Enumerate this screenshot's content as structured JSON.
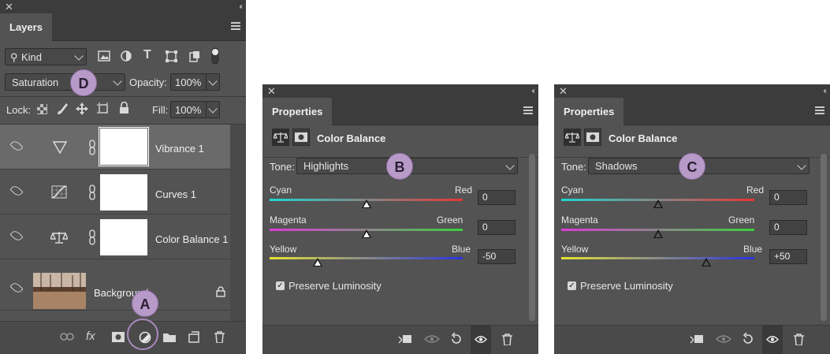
{
  "badges": {
    "a": "A",
    "b": "B",
    "c": "C",
    "d": "D"
  },
  "layers_panel": {
    "tab": "Layers",
    "filter_kind": "Kind",
    "blend_mode": "Saturation",
    "opacity_label": "Opacity:",
    "opacity_value": "100%",
    "lock_label": "Lock:",
    "fill_label": "Fill:",
    "fill_value": "100%",
    "layers": [
      {
        "name": "Vibrance 1",
        "icon": "vibrance-icon",
        "selected": true
      },
      {
        "name": "Curves 1",
        "icon": "curves-icon",
        "selected": false
      },
      {
        "name": "Color Balance 1",
        "icon": "color-balance-icon",
        "selected": false
      },
      {
        "name": "Background",
        "icon": "image-thumbnail",
        "selected": false
      }
    ],
    "bottom_icons": [
      "link-icon",
      "fx-icon",
      "mask-icon",
      "adjustment-layer-icon",
      "folder-icon",
      "new-layer-icon",
      "trash-icon"
    ],
    "fx_label": "fx"
  },
  "props_highlights": {
    "tab": "Properties",
    "title": "Color Balance",
    "tone_label": "Tone:",
    "tone_value": "Highlights",
    "sliders": [
      {
        "left": "Cyan",
        "right": "Red",
        "value": "0",
        "pos": 0.5
      },
      {
        "left": "Magenta",
        "right": "Green",
        "value": "0",
        "pos": 0.5
      },
      {
        "left": "Yellow",
        "right": "Blue",
        "value": "-50",
        "pos": 0.25
      }
    ],
    "preserve_luminosity": "Preserve Luminosity",
    "preserve_checked": true
  },
  "props_shadows": {
    "tab": "Properties",
    "title": "Color Balance",
    "tone_label": "Tone:",
    "tone_value": "Shadows",
    "sliders": [
      {
        "left": "Cyan",
        "right": "Red",
        "value": "0",
        "pos": 0.5
      },
      {
        "left": "Magenta",
        "right": "Green",
        "value": "0",
        "pos": 0.5
      },
      {
        "left": "Yellow",
        "right": "Blue",
        "value": "+50",
        "pos": 0.75
      }
    ],
    "preserve_luminosity": "Preserve Luminosity",
    "preserve_checked": true
  },
  "colors": {
    "panel": "#535353",
    "badge": "#b89ac8",
    "selected_row": "#6a6a6a"
  }
}
